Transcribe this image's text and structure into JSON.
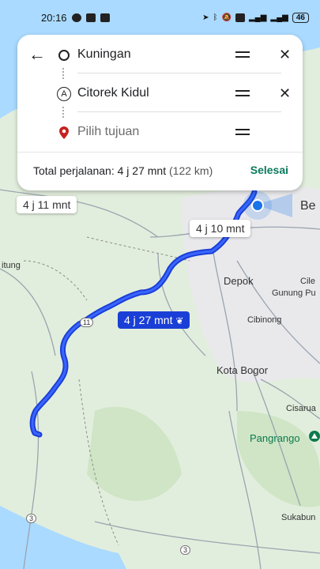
{
  "status_bar": {
    "time": "20:16",
    "battery": "46"
  },
  "directions": {
    "origin": "Kuningan",
    "stop": "Citorek Kidul",
    "stop_marker": "A",
    "destination_placeholder": "Pilih tujuan",
    "total_label": "Total perjalanan: 4 j 27 mnt",
    "total_distance": "(122 km)",
    "done_button": "Selesai"
  },
  "route_times": {
    "alt1": "4 j 11 mnt",
    "alt2": "4 j 10 mnt",
    "selected": "4 j 27 mnt"
  },
  "map_labels": {
    "depok": "Depok",
    "cileungsi": "Cile",
    "gunung_putri": "Gunung Pu",
    "cibinong": "Cibinong",
    "kota_bogor": "Kota Bogor",
    "cisarua": "Cisarua",
    "pangrango": "Pangrango",
    "sukabumi": "Sukabun",
    "bekasi": "Be",
    "itung": "itung",
    "road_11": "11",
    "road_3a": "3",
    "road_3b": "3"
  },
  "icons": {
    "back": "arrow-left-icon",
    "origin": "circle-icon",
    "stop": "marker-a-icon",
    "dest": "pin-icon",
    "drag": "drag-handle-icon",
    "close": "close-icon",
    "eco": "leaf-icon"
  },
  "colors": {
    "route": "#1a3fd6",
    "accent": "#0b7a5b",
    "water": "#aadaff",
    "land": "#e6f0e2"
  }
}
